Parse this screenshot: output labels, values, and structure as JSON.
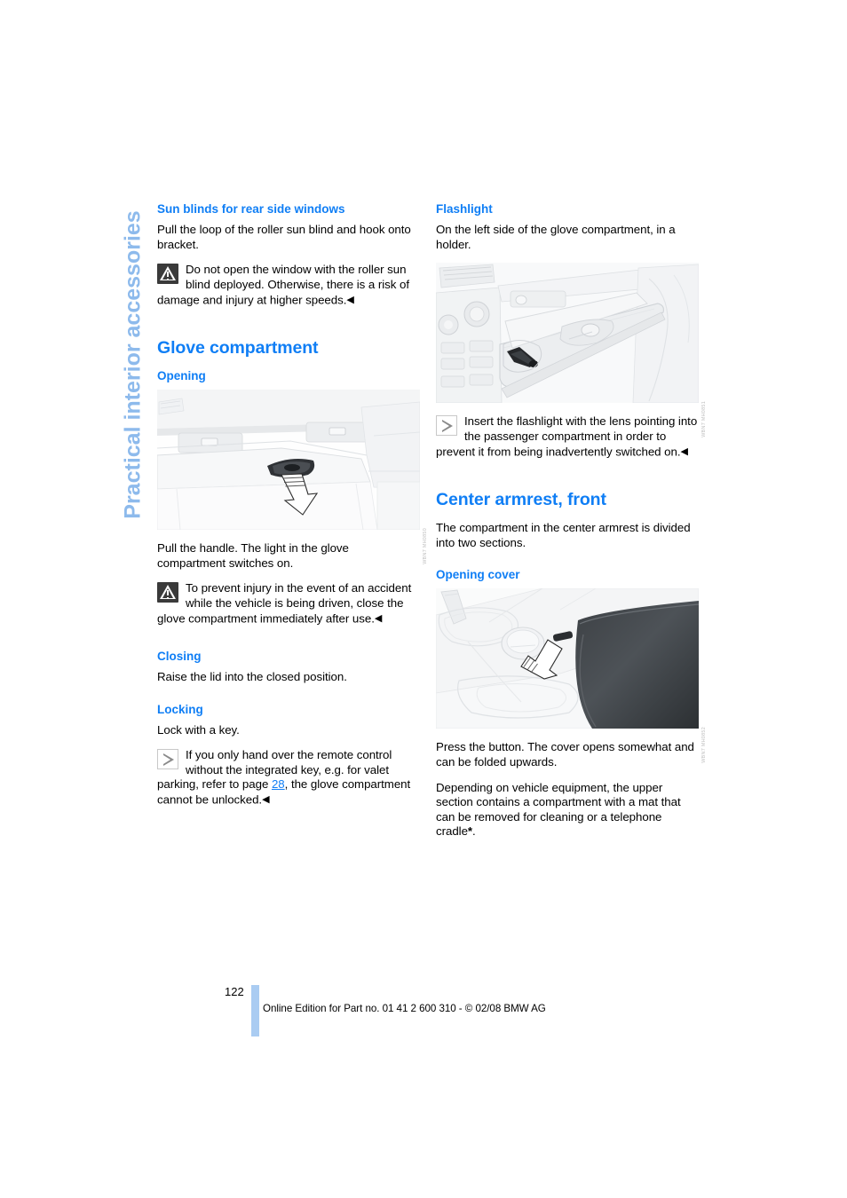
{
  "document": {
    "chapter_tab": "Practical interior accessories",
    "page_number": "122",
    "footer_note": "Online Edition for Part no. 01 41 2 600 310 - © 02/08 BMW AG"
  },
  "left_column": {
    "sunblind_heading": "Sun blinds for rear side windows",
    "sunblind_body": "Pull the loop of the roller sun blind and hook onto bracket.",
    "sunblind_warning": "Do not open the window with the roller sun blind deployed. Otherwise, there is a risk of damage and injury at higher speeds.",
    "glove_heading": "Glove compartment",
    "opening_heading": "Opening",
    "opening_figure_code": "WBN7 MH0850",
    "opening_body": "Pull the handle. The light in the glove compartment switches on.",
    "opening_warning": "To prevent injury in the event of an accident while the vehicle is being driven, close the glove compartment immediately after use.",
    "closing_heading": "Closing",
    "closing_body": "Raise the lid into the closed position.",
    "locking_heading": "Locking",
    "locking_body": "Lock with a key.",
    "locking_note_part1": "If you only hand over the remote control without the integrated key, e.g. for valet parking, refer to page ",
    "locking_note_page_ref": "28",
    "locking_note_part2": ", the glove compartment cannot be unlocked."
  },
  "right_column": {
    "flashlight_heading": "Flashlight",
    "flashlight_body": "On the left side of the glove compartment, in a holder.",
    "flashlight_figure_code": "WBN7 MH0851",
    "flashlight_note": "Insert the flashlight with the lens pointing into the passenger compartment in order to prevent it from being inadvertently switched on.",
    "armrest_heading": "Center armrest, front",
    "armrest_body": "The compartment in the center armrest is divided into two sections.",
    "opening_cover_heading": "Opening cover",
    "armrest_figure_code": "WBN7 MH0852",
    "armrest_body2": "Press the button. The cover opens somewhat and can be folded upwards.",
    "armrest_body3_part1": "Depending on vehicle equipment, the upper section contains a compartment with a mat that can be removed for cleaning or a telephone cradle",
    "armrest_body3_asterisk": "*",
    "armrest_body3_part2": "."
  },
  "icons": {
    "warning": "warning-triangle-icon",
    "note": "note-play-triangle-icon"
  },
  "colors": {
    "heading_blue": "#0f7ef5",
    "tab_blue": "#8dbaec",
    "footer_bar_blue": "#aaccf2"
  }
}
